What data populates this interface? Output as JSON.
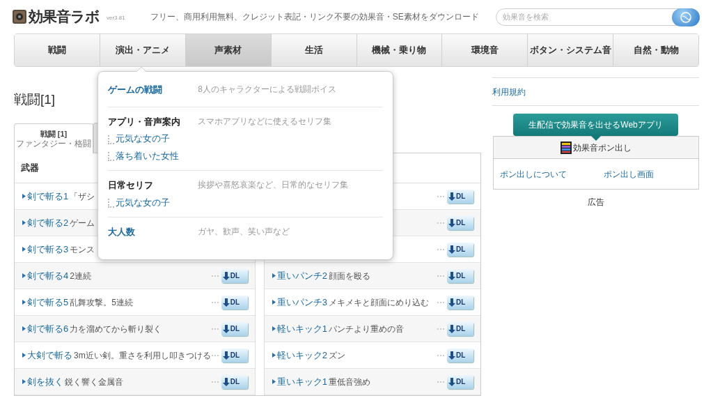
{
  "header": {
    "logo": "効果音ラボ",
    "version": "ver3.81",
    "tagline": "フリー、商用利用無料、クレジット表記・リンク不要の効果音・SE素材をダウンロード",
    "search": {
      "placeholder": "効果音を検索"
    }
  },
  "nav": [
    {
      "label": "戦闘",
      "selected": false
    },
    {
      "label": "演出・アニメ",
      "selected": false,
      "dropdown": {
        "sections": [
          {
            "title": "ゲームの戦闘",
            "kind": "link",
            "description": "8人のキャラクターによる戦闘ボイス"
          },
          {
            "title": "アプリ・音声案内",
            "kind": "heading",
            "description": "スマホアプリなどに使えるセリフ集",
            "children": [
              "元気な女の子",
              "落ち着いた女性"
            ]
          },
          {
            "title": "日常セリフ",
            "kind": "heading",
            "description": "挨拶や喜怒哀楽など、日常的なセリフ集",
            "children": [
              "元気な女の子"
            ]
          },
          {
            "title": "大人数",
            "kind": "link",
            "description": "ガヤ、歓声、笑い声など"
          }
        ]
      }
    },
    {
      "label": "声素材",
      "selected": true
    },
    {
      "label": "生活",
      "selected": false
    },
    {
      "label": "機械・乗り物",
      "selected": false
    },
    {
      "label": "環境音",
      "selected": false
    },
    {
      "label": "ボタン・システム音",
      "selected": false
    },
    {
      "label": "自然・動物",
      "selected": false
    }
  ],
  "page_title": "戦闘[1]",
  "subtabs": [
    {
      "title": "戦闘",
      "count": "[1]",
      "subtitle": "ファンタジー・格闘",
      "selected": true
    },
    {
      "selected": false
    }
  ],
  "columns": [
    {
      "heading": "武器",
      "rows": [
        {
          "name": "剣で斬る1",
          "description": "「ザシ"
        },
        {
          "name": "剣で斬る2",
          "description": "ゲーム"
        },
        {
          "name": "剣で斬る3",
          "description": "モンス"
        },
        {
          "name": "剣で斬る4",
          "description": "2連続",
          "dl": "DL"
        },
        {
          "name": "剣で斬る5",
          "description": "乱舞攻撃。5連続",
          "dl": "DL"
        },
        {
          "name": "剣で斬る6",
          "description": "力を溜めてから斬り裂く",
          "dl": "DL"
        },
        {
          "name": "大剣で斬る",
          "description": "3m近い剣。重さを利用し叩きつける",
          "dl": "DL"
        },
        {
          "name": "剣を抜く",
          "description": "鋭く響く金属音",
          "dl": "DL"
        }
      ]
    },
    {
      "rows": [
        {
          "dl": "DL"
        },
        {
          "dl": "DL"
        },
        {
          "dl": "DL"
        },
        {
          "name": "重いパンチ2",
          "description": "顔面を殴る",
          "dl": "DL"
        },
        {
          "name": "重いパンチ3",
          "description": "メキメキと顔面にめり込む",
          "dl": "DL"
        },
        {
          "name": "軽いキック1",
          "description": "パンチより重めの音",
          "dl": "DL"
        },
        {
          "name": "軽いキック2",
          "description": "ズン",
          "dl": "DL"
        },
        {
          "name": "重いキック1",
          "description": "重低音強め",
          "dl": "DL"
        }
      ]
    }
  ],
  "sidebar": {
    "terms": "利用規約",
    "callout": "生配信で効果音を出せるWebアプリ",
    "app_box": {
      "title": "効果音ポン出し",
      "links": [
        "ポン出しについて",
        "ポン出し画面"
      ]
    },
    "ad_label": "広告"
  }
}
